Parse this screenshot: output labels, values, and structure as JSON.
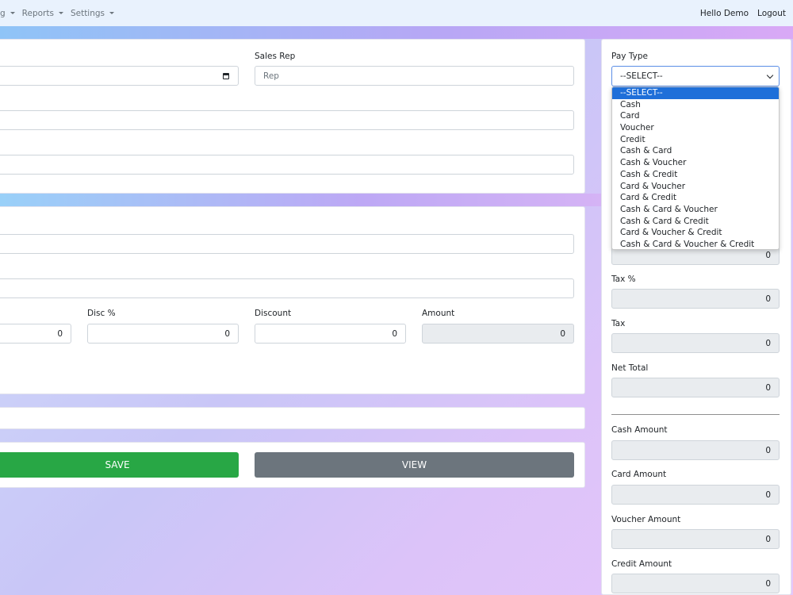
{
  "nav": {
    "partial_menu": "g",
    "reports": "Reports",
    "settings": "Settings",
    "greeting": "Hello Demo",
    "logout": "Logout"
  },
  "form": {
    "sales_rep_label": "Sales Rep",
    "sales_rep_placeholder": "Rep",
    "qty_value": "0",
    "disc_pct_label": "Disc %",
    "disc_pct_value": "0",
    "discount_label": "Discount",
    "discount_value": "0",
    "amount_label": "Amount",
    "amount_value": "0"
  },
  "buttons": {
    "save": "SAVE",
    "view": "VIEW"
  },
  "sidebar": {
    "pay_type_label": "Pay Type",
    "pay_type_selected": "--SELECT--",
    "pay_type_options": [
      "--SELECT--",
      "Cash",
      "Card",
      "Voucher",
      "Credit",
      "Cash & Card",
      "Cash & Voucher",
      "Cash & Credit",
      "Card & Voucher",
      "Card & Credit",
      "Cash & Card & Voucher",
      "Cash & Card & Credit",
      "Card & Voucher & Credit",
      "Cash & Card & Voucher & Credit"
    ],
    "hidden_total_value": "0",
    "tax_pct_label": "Tax %",
    "tax_pct_value": "0",
    "tax_label": "Tax",
    "tax_value": "0",
    "net_total_label": "Net Total",
    "net_total_value": "0",
    "cash_amount_label": "Cash Amount",
    "cash_amount_value": "0",
    "card_amount_label": "Card Amount",
    "card_amount_value": "0",
    "voucher_amount_label": "Voucher Amount",
    "voucher_amount_value": "0",
    "credit_amount_label": "Credit Amount",
    "credit_amount_value": "0"
  }
}
